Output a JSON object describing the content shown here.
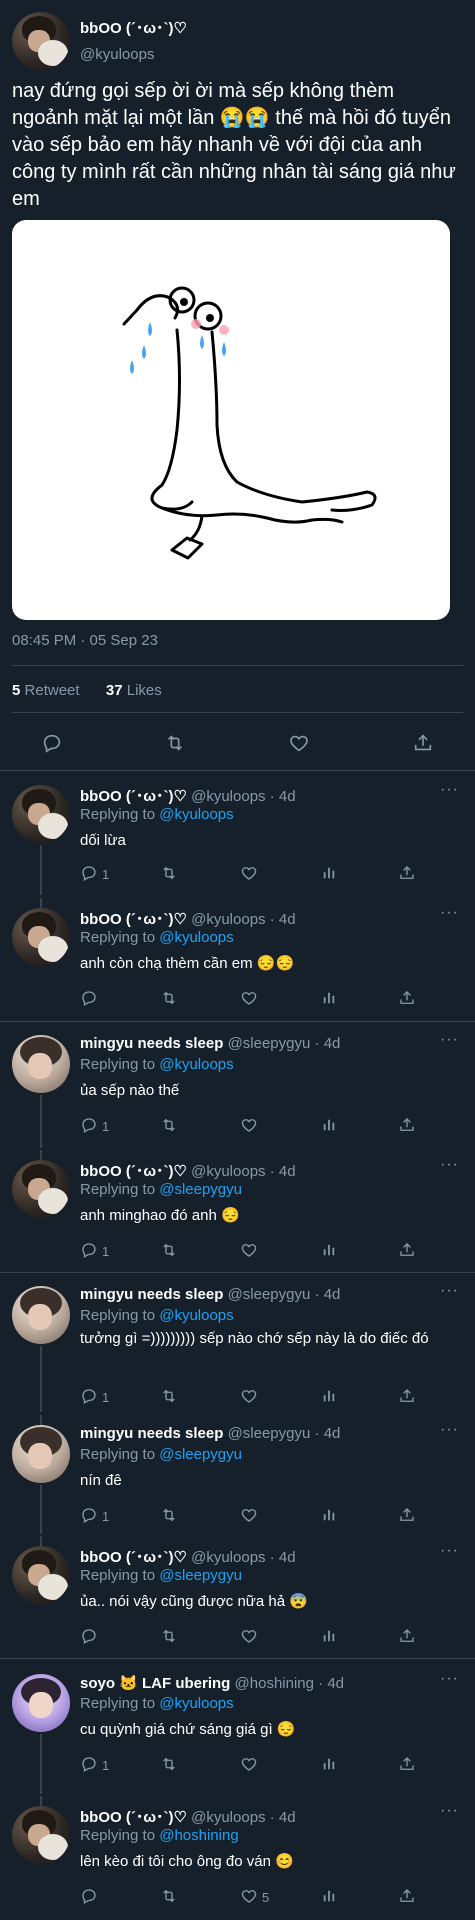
{
  "tweet": {
    "display_name": "bbOO (´･ω･`)♡",
    "handle": "@kyuloops",
    "text": "nay đứng gọi sếp ời ời mà sếp không thèm ngoảnh mặt lại một lần 😭😭 thế mà hồi đó tuyển vào sếp bảo em hãy nhanh về với đội của anh công ty mình rất cần những nhân tài sáng giá như em",
    "timestamp": "08:45 PM · 05 Sep 23",
    "retweet_count": "5",
    "retweet_label": "Retweet",
    "like_count": "37",
    "like_label": "Likes"
  },
  "icons": {
    "reply": "reply-icon",
    "retweet": "retweet-icon",
    "like": "heart-icon",
    "share": "share-icon",
    "views": "views-icon"
  },
  "colors": {
    "background": "#15202b",
    "secondary_text": "#8899a6",
    "link": "#1da1f2",
    "divider": "#38444d"
  },
  "replies": [
    {
      "name": "bbOO (´･ω･`)♡",
      "handle": "@kyuloops",
      "age": "4d",
      "replying_label": "Replying to",
      "replying_to": "@kyuloops",
      "text": "dối lừa",
      "reply_count": "1",
      "like_count": ""
    },
    {
      "name": "bbOO (´･ω･`)♡",
      "handle": "@kyuloops",
      "age": "4d",
      "replying_label": "Replying to",
      "replying_to": "@kyuloops",
      "text": "anh còn chạ thèm cần em 😔😔",
      "reply_count": "",
      "like_count": ""
    },
    {
      "name": "mingyu needs sleep",
      "handle": "@sleepygyu",
      "age": "4d",
      "replying_label": "Replying to",
      "replying_to": "@kyuloops",
      "text": "ủa sếp nào thế",
      "reply_count": "1",
      "like_count": ""
    },
    {
      "name": "bbOO (´･ω･`)♡",
      "handle": "@kyuloops",
      "age": "4d",
      "replying_label": "Replying to",
      "replying_to": "@sleepygyu",
      "text": "anh minghao đó anh 😔",
      "reply_count": "1",
      "like_count": ""
    },
    {
      "name": "mingyu needs sleep",
      "handle": "@sleepygyu",
      "age": "4d",
      "replying_label": "Replying to",
      "replying_to": "@kyuloops",
      "text": "tưởng gì =))))))))) sếp nào chớ sếp này là do điếc đó",
      "reply_count": "1",
      "like_count": ""
    },
    {
      "name": "mingyu needs sleep",
      "handle": "@sleepygyu",
      "age": "4d",
      "replying_label": "Replying to",
      "replying_to": "@sleepygyu",
      "text": "nín đê",
      "reply_count": "1",
      "like_count": ""
    },
    {
      "name": "bbOO (´･ω･`)♡",
      "handle": "@kyuloops",
      "age": "4d",
      "replying_label": "Replying to",
      "replying_to": "@sleepygyu",
      "text": "ủa.. nói vậy cũng được nữa hả 😨",
      "reply_count": "",
      "like_count": ""
    },
    {
      "name": "soyo 🐱 LAF ubering",
      "handle": "@hoshining",
      "age": "4d",
      "replying_label": "Replying to",
      "replying_to": "@kyuloops",
      "text": "cu quỳnh giá chứ sáng giá gì 😔",
      "reply_count": "1",
      "like_count": ""
    },
    {
      "name": "bbOO (´･ω･`)♡",
      "handle": "@kyuloops",
      "age": "4d",
      "replying_label": "Replying to",
      "replying_to": "@hoshining",
      "text": "lên kèo đi tôi cho ông đo ván 😊",
      "reply_count": "",
      "like_count": "5"
    }
  ]
}
